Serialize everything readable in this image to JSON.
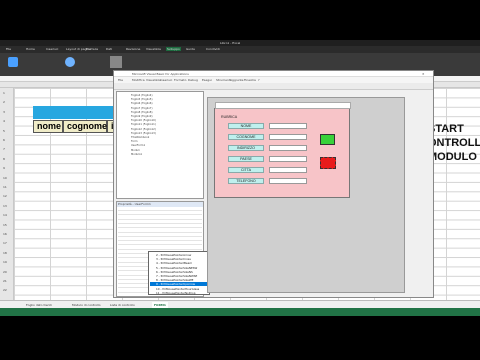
{
  "excel": {
    "title": "Libro1 - Excel",
    "tabs": [
      "File",
      "Home",
      "Inserisci",
      "Layout di pagina",
      "Formule",
      "Dati",
      "Revisione",
      "Visualizza",
      "Sviluppo",
      "Guida",
      "Condividi"
    ],
    "active_tab": "Sviluppo",
    "column_headers": [
      "nome",
      "cognome",
      "in"
    ],
    "right_note": [
      "START",
      "ONTROLLO",
      "MODULO"
    ],
    "sheet_tabs": [
      "Foglio dati clienti",
      "Modulo di controllo",
      "Lista di controllo",
      "FORM1"
    ],
    "active_sheet": "FORM1",
    "row_numbers": [
      "1",
      "2",
      "3",
      "4",
      "5",
      "6",
      "7",
      "8",
      "9",
      "10",
      "11",
      "12",
      "13",
      "14",
      "15",
      "16",
      "17",
      "18",
      "19",
      "20",
      "21",
      "22"
    ]
  },
  "vba": {
    "title": "Microsoft Visual Basic for Applications",
    "menu": [
      "File",
      "Modifica",
      "Visualizza",
      "Inserisci",
      "Formato",
      "Debug",
      "Esegui",
      "Strumenti",
      "Aggiunte",
      "Finestra",
      "?"
    ],
    "project_items": [
      "Foglio4 (Foglio4)",
      "Foglio5 (Foglio5)",
      "Foglio6 (Foglio6)",
      "Foglio7 (Foglio7)",
      "Foglio8 (Foglio8)",
      "Foglio9 (Foglio9)",
      "Foglio10 (Foglio10)",
      "Foglio11 (Foglio11)",
      "Foglio12 (Foglio12)",
      "Foglio13 (Foglio13)",
      "ThisWorkbook",
      "Form",
      "UserForm1",
      "Moduli",
      "Modulo1"
    ],
    "props_title": "Proprietà - UserForm1",
    "dropdown_items": [
      "2 - fmMousePointerArrow",
      "3 - fmMousePointerCross",
      "4 - fmMousePointerIBeam",
      "5 - fmMousePointerSizeNESW",
      "6 - fmMousePointerSizeNS",
      "7 - fmMousePointerSizeNWSE",
      "8 - fmMousePointerSizeWE",
      "9 - fmMousePointerUpArrow",
      "10 - fmMousePointerHourGlass",
      "11 - fmMousePointerNoDrop"
    ],
    "selected_dropdown": "9 - fmMousePointerUpArrow"
  },
  "userform": {
    "caption": "RUBRICA",
    "labels": [
      "NOME",
      "COGNOME",
      "INDIRIZZO",
      "PAESE",
      "CITTA",
      "TELEFONO"
    ]
  }
}
